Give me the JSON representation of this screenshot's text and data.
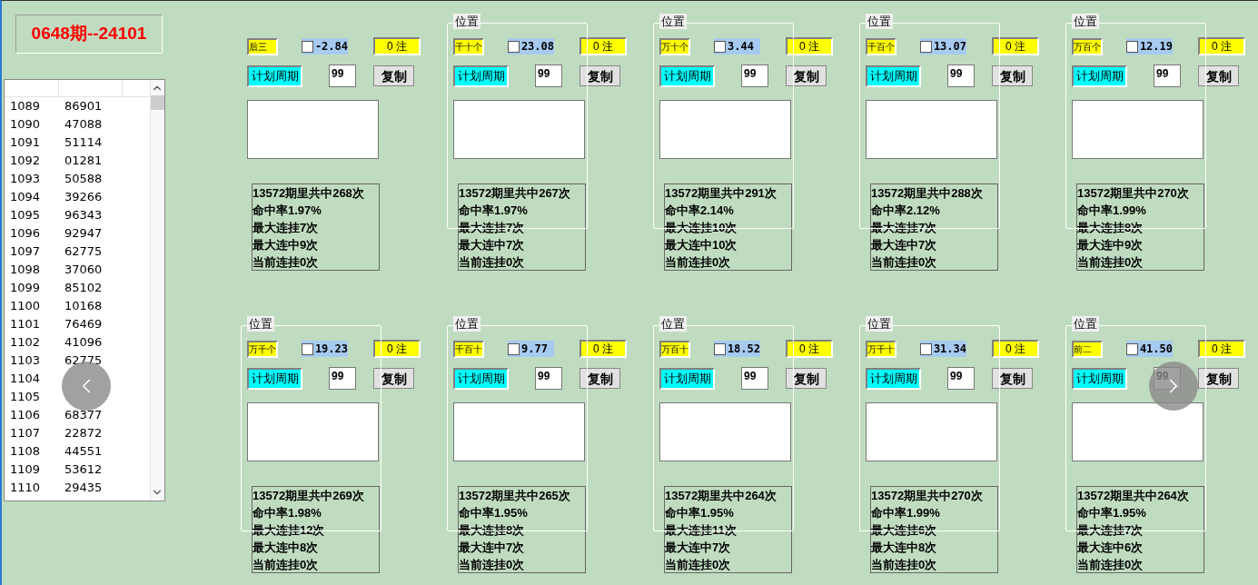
{
  "header": {
    "title": "0648期--24101"
  },
  "history": {
    "rows": [
      {
        "period": "1089",
        "number": "86901"
      },
      {
        "period": "1090",
        "number": "47088"
      },
      {
        "period": "1091",
        "number": "51114"
      },
      {
        "period": "1092",
        "number": "01281"
      },
      {
        "period": "1093",
        "number": "50588"
      },
      {
        "period": "1094",
        "number": "39266"
      },
      {
        "period": "1095",
        "number": "96343"
      },
      {
        "period": "1096",
        "number": "92947"
      },
      {
        "period": "1097",
        "number": "62775"
      },
      {
        "period": "1098",
        "number": "37060"
      },
      {
        "period": "1099",
        "number": "85102"
      },
      {
        "period": "1100",
        "number": "10168"
      },
      {
        "period": "1101",
        "number": "76469"
      },
      {
        "period": "1102",
        "number": "41096"
      },
      {
        "period": "1103",
        "number": "62775"
      },
      {
        "period": "1104"
      },
      {
        "period": "1105"
      },
      {
        "period": "1106",
        "number": "68377"
      },
      {
        "period": "1107",
        "number": "22872"
      },
      {
        "period": "1108",
        "number": "44551"
      },
      {
        "period": "1109",
        "number": "53612"
      },
      {
        "period": "1110",
        "number": "29435"
      }
    ]
  },
  "panels": [
    {
      "position": "后三",
      "checked": false,
      "value": "-2.84",
      "count": "0 注",
      "period_label": "计划周期",
      "period": "99",
      "copy": "复制",
      "stats": [
        "13572期里共中268次",
        "命中率1.97%",
        "最大连挂7次",
        "最大连中9次",
        "当前连挂0次"
      ]
    },
    {
      "legend": "位置",
      "position": "千十个",
      "checked": false,
      "value": "23.08",
      "count": "0 注",
      "period_label": "计划周期",
      "period": "99",
      "copy": "复制",
      "stats": [
        "13572期里共中267次",
        "命中率1.97%",
        "最大连挂7次",
        "最大连中7次",
        "当前连挂0次"
      ]
    },
    {
      "legend": "位置",
      "position": "万十个",
      "checked": false,
      "value": "3.44",
      "count": "0 注",
      "period_label": "计划周期",
      "period": "99",
      "copy": "复制",
      "stats": [
        "13572期里共中291次",
        "命中率2.14%",
        "最大连挂10次",
        "最大连中10次",
        "当前连挂0次"
      ]
    },
    {
      "legend": "位置",
      "position": "千百个",
      "checked": false,
      "value": "13.07",
      "count": "0 注",
      "period_label": "计划周期",
      "period": "99",
      "copy": "复制",
      "stats": [
        "13572期里共中288次",
        "命中率2.12%",
        "最大连挂7次",
        "最大连中7次",
        "当前连挂0次"
      ]
    },
    {
      "legend": "位置",
      "position": "万百个",
      "checked": false,
      "value": "12.19",
      "count": "0 注",
      "period_label": "计划周期",
      "period": "99",
      "copy": "复制",
      "stats": [
        "13572期里共中270次",
        "命中率1.99%",
        "最大连挂8次",
        "最大连中9次",
        "当前连挂0次"
      ]
    },
    {
      "legend": "位置",
      "position": "万千个",
      "checked": false,
      "value": "19.23",
      "count": "0 注",
      "period_label": "计划周期",
      "period": "99",
      "copy": "复制",
      "stats": [
        "13572期里共中269次",
        "命中率1.98%",
        "最大连挂12次",
        "最大连中8次",
        "当前连挂0次"
      ]
    },
    {
      "legend": "位置",
      "position": "千百十",
      "checked": false,
      "value": "9.77",
      "count": "0 注",
      "period_label": "计划周期",
      "period": "99",
      "copy": "复制",
      "stats": [
        "13572期里共中265次",
        "命中率1.95%",
        "最大连挂8次",
        "最大连中7次",
        "当前连挂0次"
      ]
    },
    {
      "legend": "位置",
      "position": "万百十",
      "checked": false,
      "value": "18.52",
      "count": "0 注",
      "period_label": "计划周期",
      "period": "99",
      "copy": "复制",
      "stats": [
        "13572期里共中264次",
        "命中率1.95%",
        "最大连挂11次",
        "最大连中7次",
        "当前连挂0次"
      ]
    },
    {
      "legend": "位置",
      "position": "万千十",
      "checked": false,
      "value": "31.34",
      "count": "0 注",
      "period_label": "计划周期",
      "period": "99",
      "copy": "复制",
      "stats": [
        "13572期里共中270次",
        "命中率1.99%",
        "最大连挂6次",
        "最大连中8次",
        "当前连挂0次"
      ]
    },
    {
      "legend": "位置",
      "position": "前二",
      "checked": false,
      "value": "41.50",
      "count": "0 注",
      "period_label": "计划周期",
      "period": "99",
      "copy": "复制",
      "stats": [
        "13572期里共中264次",
        "命中率1.95%",
        "最大连挂7次",
        "最大连中6次",
        "当前连挂0次"
      ]
    }
  ]
}
